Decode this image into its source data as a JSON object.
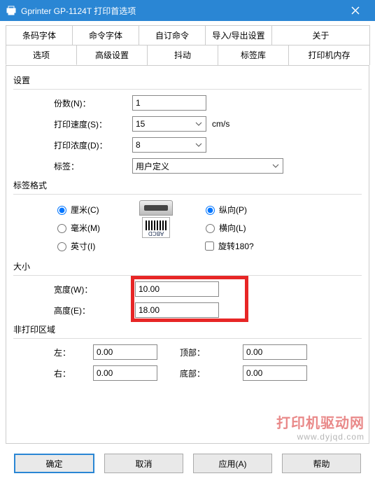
{
  "title": "Gprinter GP-1124T 打印首选项",
  "tabs_row1": [
    "条码字体",
    "命令字体",
    "自订命令",
    "导入/导出设置",
    "关于"
  ],
  "tabs_row2": [
    "选项",
    "高级设置",
    "抖动",
    "标签库",
    "打印机内存"
  ],
  "section_settings": "设置",
  "copies_label": "份数(N)：",
  "copies_value": "1",
  "speed_label": "打印速度(S)：",
  "speed_value": "15",
  "speed_unit": "cm/s",
  "density_label": "打印浓度(D)：",
  "density_value": "8",
  "label_label": "标签：",
  "label_value": "用户定义",
  "section_format": "标签格式",
  "unit_cm": "厘米(C)",
  "unit_mm": "毫米(M)",
  "unit_in": "英寸(I)",
  "orient_portrait": "纵向(P)",
  "orient_landscape": "横向(L)",
  "rotate180": "旋转180?",
  "printer_badge": "ABCD",
  "section_size": "大小",
  "width_label": "宽度(W)：",
  "width_value": "10.00",
  "height_label": "高度(E)：",
  "height_value": "18.00",
  "section_nonprint": "非打印区域",
  "left_label": "左：",
  "left_value": "0.00",
  "right_label": "右：",
  "right_value": "0.00",
  "top_label": "顶部：",
  "top_value": "0.00",
  "bottom_label": "底部：",
  "bottom_value": "0.00",
  "btn_ok": "确定",
  "btn_cancel": "取消",
  "btn_apply": "应用(A)",
  "btn_help": "帮助",
  "watermark_main": "打印机驱动网",
  "watermark_sub": "www.dyjqd.com"
}
